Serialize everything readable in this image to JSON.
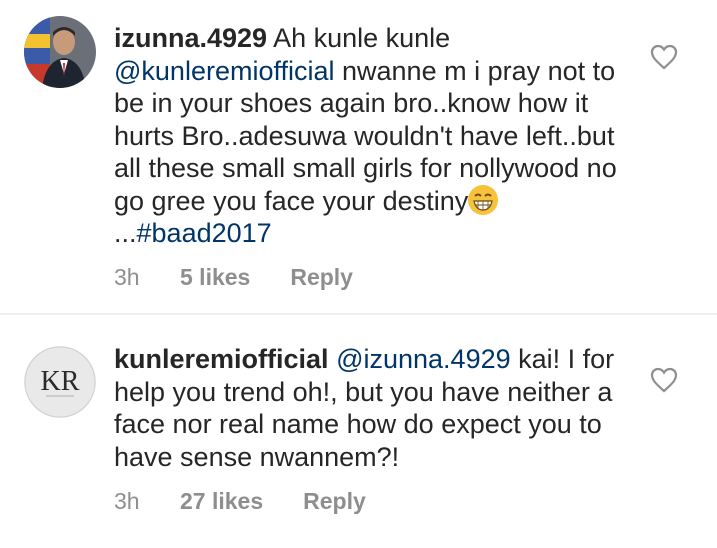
{
  "comments": [
    {
      "username": "izunna.4929",
      "text_lead": " Ah kunle kunle ",
      "mention": "@kunleremiofficial",
      "text_main": "  nwanne m i pray not to be in your shoes again bro..know how it hurts Bro..adesuwa wouldn't have left..but all these small small girls for nollywood no go gree you face your destiny",
      "emoji_icon": "grinning-face-emoji",
      "text_after_emoji": "...",
      "hashtag": "#baad2017",
      "time": "3h",
      "likes": "5 likes",
      "reply": "Reply",
      "avatar_icon": "profile-photo"
    },
    {
      "username": "kunleremiofficial",
      "mention": " @izunna.4929",
      "text_main": "  kai! I for help you trend oh!, but you have neither a face nor real name how do  expect you to have sense nwannem?!",
      "time": "3h",
      "likes": "27 likes",
      "reply": "Reply",
      "avatar_icon": "kr-logo",
      "avatar_logo_text": "KR"
    }
  ],
  "colors": {
    "link": "#003569",
    "meta": "#8e8e8e",
    "text": "#262626",
    "divider": "#efefef"
  }
}
